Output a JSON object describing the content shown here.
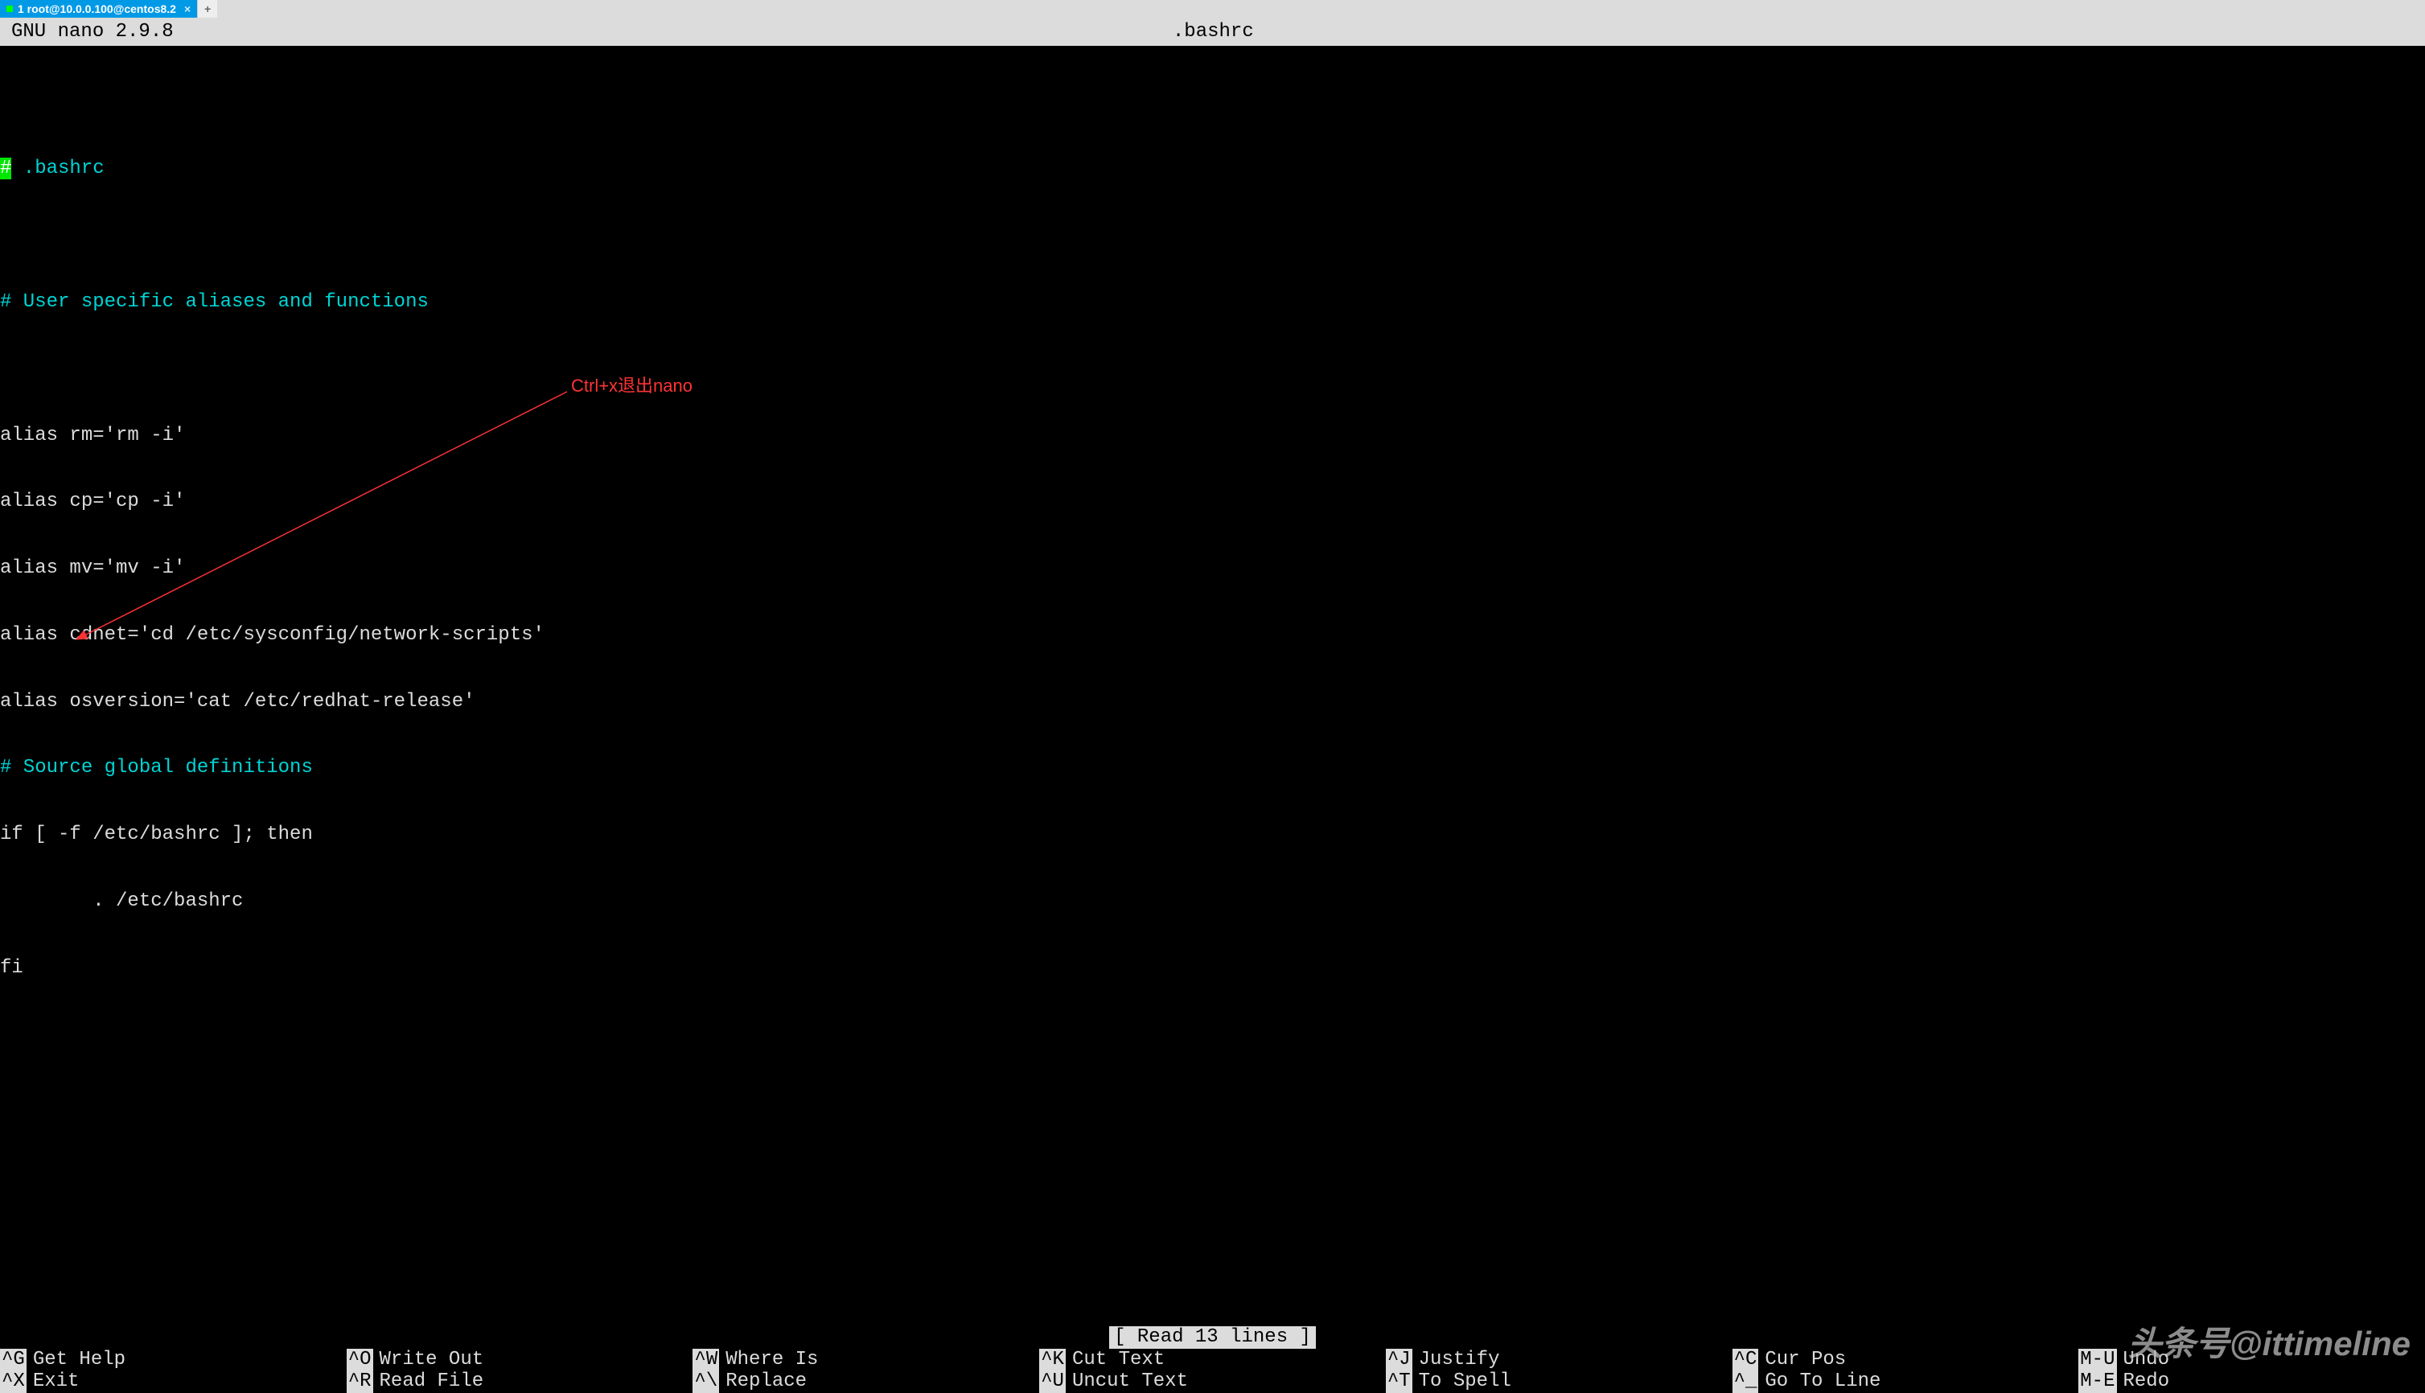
{
  "tab": {
    "label": "1 root@10.0.0.100@centos8.2",
    "close": "×",
    "add": "+"
  },
  "titlebar": {
    "left": "  GNU nano 2.9.8",
    "center": ".bashrc"
  },
  "file": {
    "line1_hash": "#",
    "line1_rest": " .bashrc",
    "line2": "# User specific aliases and functions",
    "alias1": "alias rm='rm -i'",
    "alias2": "alias cp='cp -i'",
    "alias3": "alias mv='mv -i'",
    "alias4": "alias cdnet='cd /etc/sysconfig/network-scripts'",
    "alias5": "alias osversion='cat /etc/redhat-release'",
    "line3": "# Source global definitions",
    "if1": "if [ -f /etc/bashrc ]; then",
    "if2": "        . /etc/bashrc",
    "if3": "fi"
  },
  "annotation": {
    "text": "Ctrl+x退出nano"
  },
  "status": {
    "text": "[ Read 13 lines ]"
  },
  "shortcuts": {
    "row1": [
      {
        "key": "^G",
        "label": "Get Help"
      },
      {
        "key": "^O",
        "label": "Write Out"
      },
      {
        "key": "^W",
        "label": "Where Is"
      },
      {
        "key": "^K",
        "label": "Cut Text"
      },
      {
        "key": "^J",
        "label": "Justify"
      },
      {
        "key": "^C",
        "label": "Cur Pos"
      },
      {
        "key": "M-U",
        "label": "Undo"
      }
    ],
    "row2": [
      {
        "key": "^X",
        "label": "Exit"
      },
      {
        "key": "^R",
        "label": "Read File"
      },
      {
        "key": "^\\",
        "label": "Replace"
      },
      {
        "key": "^U",
        "label": "Uncut Text"
      },
      {
        "key": "^T",
        "label": "To Spell"
      },
      {
        "key": "^_",
        "label": "Go To Line"
      },
      {
        "key": "M-E",
        "label": "Redo"
      }
    ]
  },
  "watermark": "头条号@ittimeline"
}
